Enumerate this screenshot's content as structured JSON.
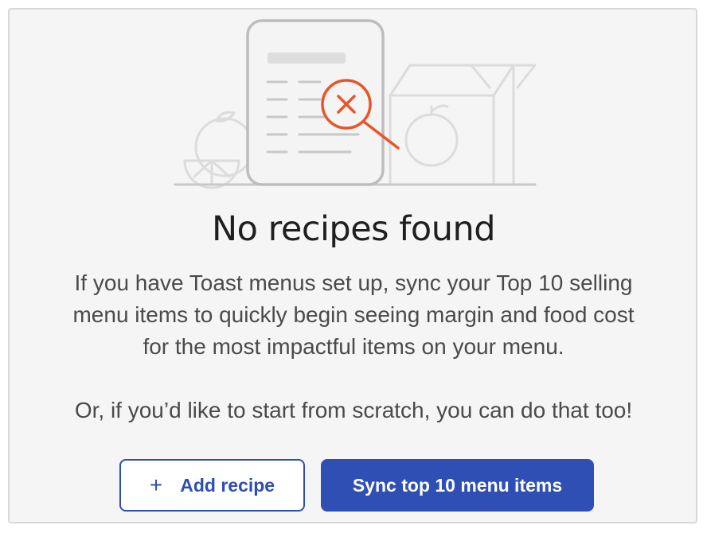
{
  "empty_state": {
    "title": "No recipes found",
    "description_line1": "If you have Toast menus set up, sync your Top 10 selling",
    "description_line2": "menu items to quickly begin seeing margin and food cost",
    "description_line3": "for the most impactful items on your menu.",
    "description_line4": "Or, if you’d like to start from scratch, you can do that too!",
    "illustration_icons": [
      "recipe-card-icon",
      "magnifier-x-icon",
      "citrus-icon",
      "box-icon",
      "apple-icon"
    ]
  },
  "actions": {
    "add_recipe": {
      "icon": "plus-icon",
      "icon_glyph": "+",
      "label": "Add recipe"
    },
    "sync": {
      "label": "Sync top 10 menu items"
    }
  },
  "colors": {
    "accent": "#2f4fb5",
    "error_orange": "#e8552b",
    "illustration_gray": "#cfcfcf",
    "panel_bg": "#f5f5f5"
  }
}
